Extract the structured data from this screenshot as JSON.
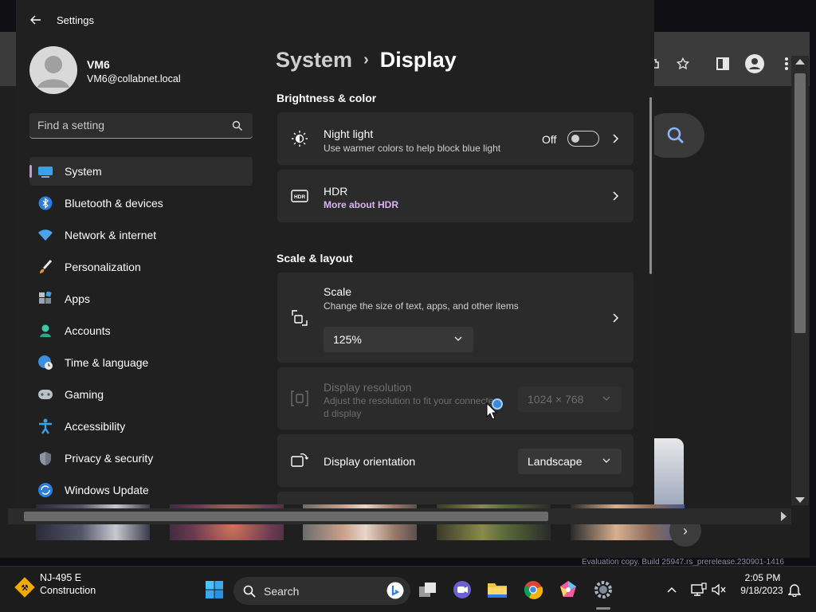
{
  "settings": {
    "window_title": "Settings",
    "user": {
      "name": "VM6",
      "email": "VM6@collabnet.local"
    },
    "search": {
      "placeholder": "Find a setting"
    },
    "nav": [
      {
        "label": "System",
        "icon": "system-icon",
        "active": true
      },
      {
        "label": "Bluetooth & devices",
        "icon": "bluetooth-icon"
      },
      {
        "label": "Network & internet",
        "icon": "wifi-icon"
      },
      {
        "label": "Personalization",
        "icon": "brush-icon"
      },
      {
        "label": "Apps",
        "icon": "apps-icon"
      },
      {
        "label": "Accounts",
        "icon": "accounts-icon"
      },
      {
        "label": "Time & language",
        "icon": "globe-clock-icon"
      },
      {
        "label": "Gaming",
        "icon": "gamepad-icon"
      },
      {
        "label": "Accessibility",
        "icon": "accessibility-icon"
      },
      {
        "label": "Privacy & security",
        "icon": "shield-icon"
      },
      {
        "label": "Windows Update",
        "icon": "update-icon"
      }
    ],
    "breadcrumb": {
      "parent": "System",
      "separator": "›",
      "current": "Display"
    },
    "sections": {
      "brightness": "Brightness & color",
      "scale_layout": "Scale & layout"
    },
    "night_light": {
      "title": "Night light",
      "subtitle": "Use warmer colors to help block blue light",
      "state_label": "Off",
      "state": false
    },
    "hdr": {
      "title": "HDR",
      "link": "More about HDR"
    },
    "scale": {
      "title": "Scale",
      "subtitle": "Change the size of text, apps, and other items",
      "value": "125%"
    },
    "resolution": {
      "title": "Display resolution",
      "subtitle_line1": "Adjust the resolution to fit your connecte",
      "subtitle_line2": "d display",
      "value": "1024 × 768",
      "disabled": true
    },
    "orientation": {
      "title": "Display orientation",
      "value": "Landscape"
    }
  },
  "background": {
    "evaluation_text": "Evaluation copy. Build 25947.rs_prerelease.230901-1416"
  },
  "taskbar": {
    "weather": {
      "title": "NJ-495 E",
      "subtitle": "Construction"
    },
    "search_label": "Search",
    "clock": {
      "time": "2:05 PM",
      "date": "9/18/2023"
    },
    "apps": [
      "start-icon",
      "search",
      "task-view-icon",
      "teams-icon",
      "file-explorer-icon",
      "chrome-icon",
      "copilot-icon",
      "settings-icon"
    ]
  },
  "colors": {
    "accent": "#c792ea",
    "link": "#d9b3f2",
    "card": "#2b2b2b",
    "window": "#202020"
  }
}
